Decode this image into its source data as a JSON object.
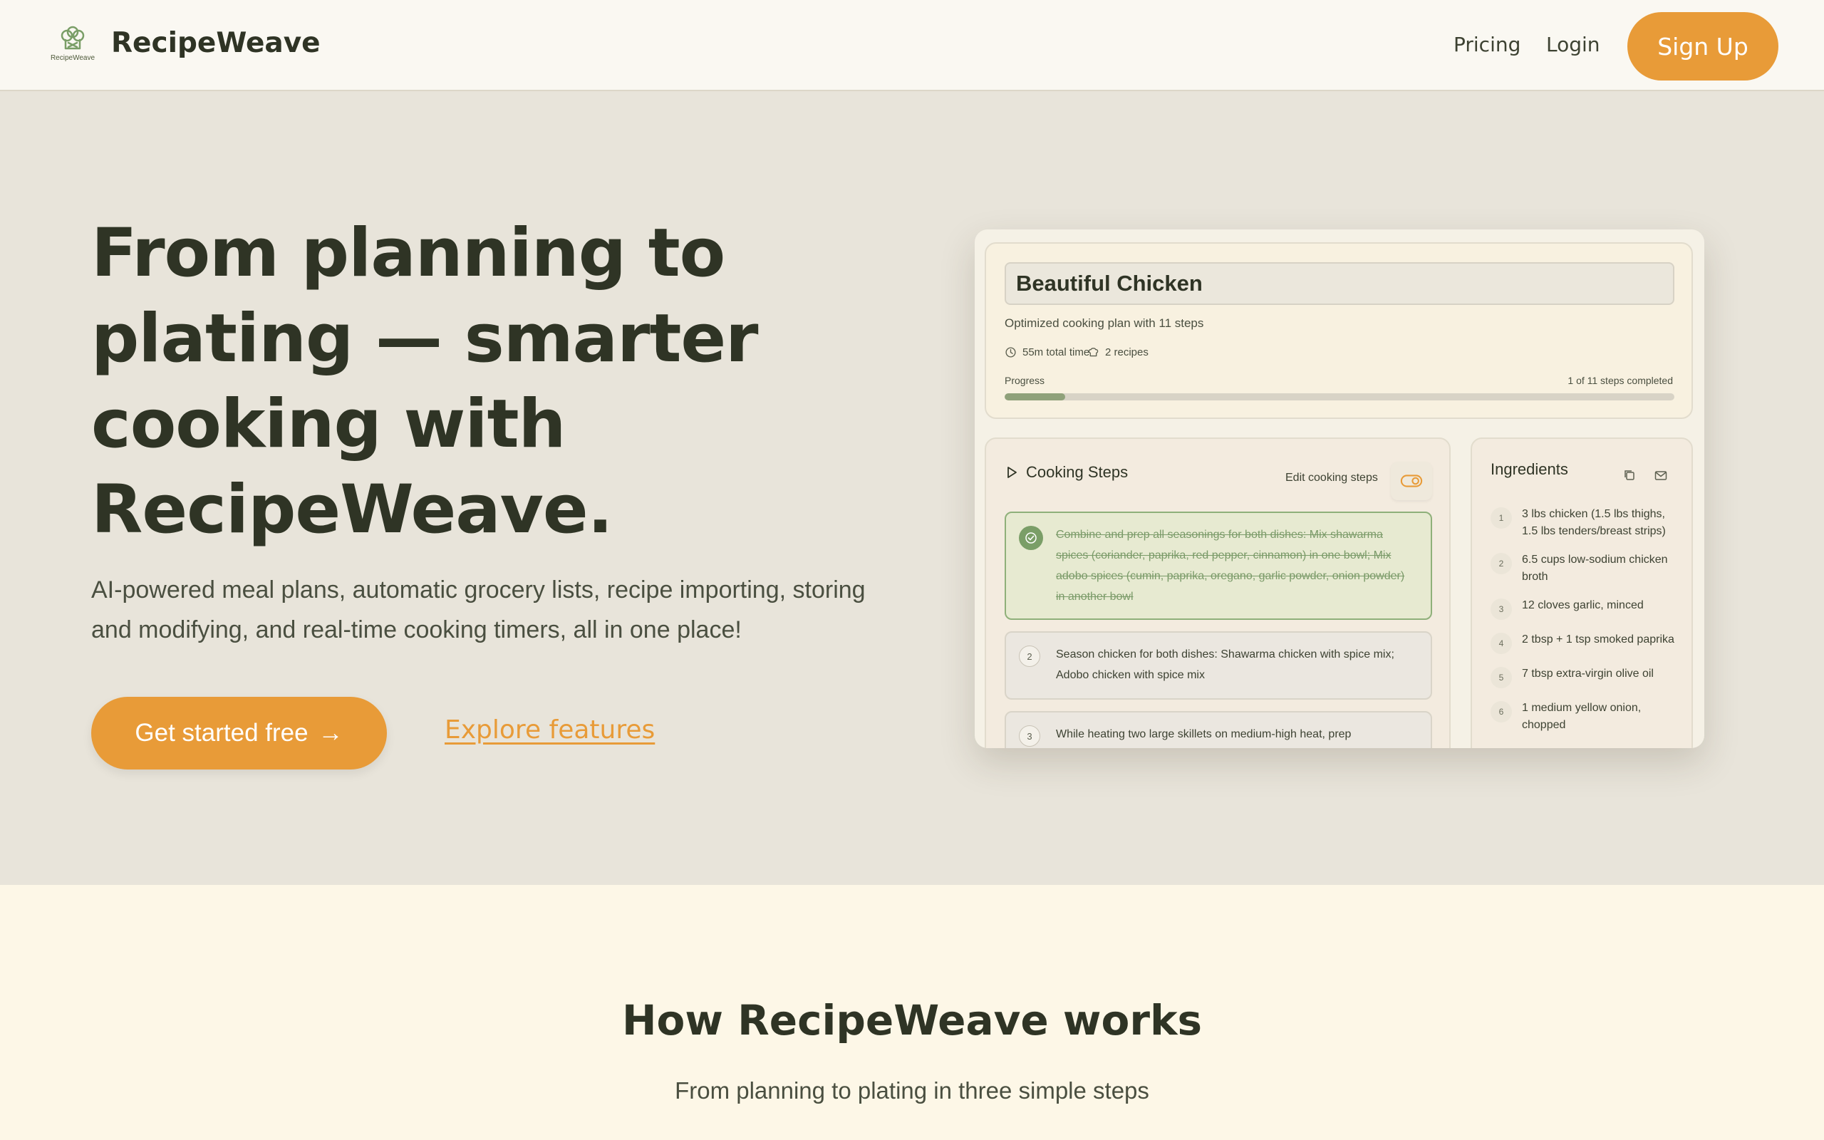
{
  "header": {
    "logo_text": "RecipeWeave",
    "brand": "RecipeWeave",
    "nav": {
      "pricing": "Pricing",
      "login": "Login"
    },
    "signup_label": "Sign Up"
  },
  "hero": {
    "title": "From planning to plating — smarter cooking with RecipeWeave.",
    "subtitle": "AI-powered meal plans, automatic grocery lists, recipe importing, storing and modifying, and real-time cooking timers, all in one place!",
    "cta_label": "Get started free",
    "cta_arrow": "→",
    "explore_label": "Explore features"
  },
  "preview": {
    "plan": {
      "title": "Beautiful Chicken",
      "subtitle": "Optimized cooking plan with 11 steps",
      "total_time": "55m total time",
      "recipes": "2 recipes",
      "progress_label": "Progress",
      "progress_count": "1 of 11 steps completed",
      "progress_fraction": 0.09
    },
    "steps": {
      "heading": "Cooking Steps",
      "edit_label": "Edit cooking steps",
      "items": [
        {
          "num": "1",
          "text": "Combine and prep all seasonings for both dishes: Mix shawarma spices (coriander, paprika, red pepper, cinnamon) in one bowl; Mix adobo spices (cumin, paprika, oregano, garlic powder, onion powder) in another bowl",
          "done": true
        },
        {
          "num": "2",
          "text": "Season chicken for both dishes: Shawarma chicken with spice mix; Adobo chicken with spice mix",
          "done": false
        },
        {
          "num": "3",
          "text": "While heating two large skillets on medium-high heat, prep",
          "done": false
        }
      ]
    },
    "ingredients": {
      "heading": "Ingredients",
      "items": [
        {
          "num": "1",
          "text": "3 lbs chicken (1.5 lbs thighs, 1.5 lbs tenders/breast strips)"
        },
        {
          "num": "2",
          "text": "6.5 cups low-sodium chicken broth"
        },
        {
          "num": "3",
          "text": "12 cloves garlic, minced"
        },
        {
          "num": "4",
          "text": "2 tbsp + 1 tsp smoked paprika"
        },
        {
          "num": "5",
          "text": "7 tbsp extra-virgin olive oil"
        },
        {
          "num": "6",
          "text": "1 medium yellow onion, chopped"
        }
      ]
    }
  },
  "how": {
    "title": "How RecipeWeave works",
    "subtitle": "From planning to plating in three simple steps"
  },
  "colors": {
    "accent": "#e89b38",
    "hero_bg": "#e8e4da",
    "header_bg": "#faf8f2",
    "section_bg": "#fdf7e7",
    "done_green": "#7a9e67"
  }
}
